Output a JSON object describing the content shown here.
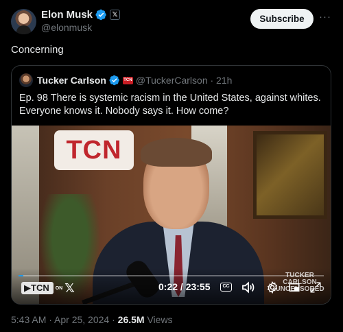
{
  "author": {
    "name": "Elon Musk",
    "handle": "@elonmusk",
    "affiliate_badge": "𝕏"
  },
  "actions": {
    "subscribe_label": "Subscribe",
    "more_label": "···"
  },
  "post": {
    "text": "Concerning"
  },
  "quote": {
    "name": "Tucker Carlson",
    "badge_text": "TCN",
    "handle_time": "@TuckerCarlson · 21h",
    "text": "Ep. 98  There is systemic racism in the United States, against whites. Everyone knows it. Nobody says it. How come?"
  },
  "video": {
    "logo_text": "TCN",
    "brand_label": "▶TCN",
    "on_label": "ON",
    "x_label": "𝕏",
    "time": "0:22 / 23:55",
    "cc_label": "CC",
    "watermark": "TUCKER CARLSON UNCENSORED",
    "progress": 0.0154
  },
  "meta": {
    "timestamp": "5:43 AM · Apr 25, 2024 · ",
    "views_count": "26.5M",
    "views_label": " Views"
  },
  "colors": {
    "background": "#000000",
    "text": "#e7e9ea",
    "muted": "#71767b",
    "verified": "#1d9bf0",
    "border": "#2f3336"
  }
}
